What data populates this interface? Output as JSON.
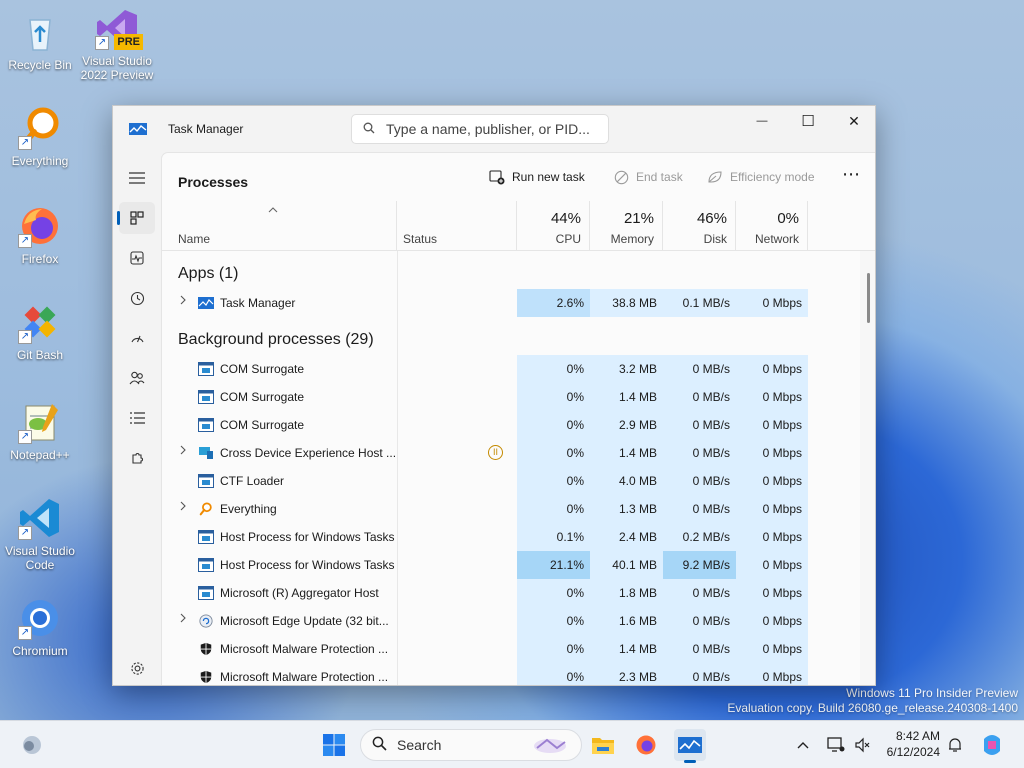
{
  "desktop": {
    "icons": [
      {
        "label": "Recycle Bin"
      },
      {
        "label": "Visual Studio 2022 Preview",
        "badge": "PRE"
      },
      {
        "label": "Everything"
      },
      {
        "label": "Firefox"
      },
      {
        "label": "Git Bash"
      },
      {
        "label": "Notepad++"
      },
      {
        "label": "Visual Studio Code"
      },
      {
        "label": "Chromium"
      }
    ],
    "watermark": {
      "line1": "Windows 11 Pro Insider Preview",
      "line2": "Evaluation copy. Build 26080.ge_release.240308-1400"
    }
  },
  "window": {
    "title": "Task Manager",
    "search_placeholder": "Type a name, publisher, or PID...",
    "controls": {
      "minimize": "—",
      "maximize": "☐",
      "close": "✕"
    }
  },
  "toolbar": {
    "page_title": "Processes",
    "run_new_task": "Run new task",
    "end_task": "End task",
    "efficiency_mode": "Efficiency mode",
    "more": "⋯"
  },
  "columns": {
    "name": "Name",
    "status": "Status",
    "cpu": {
      "pct": "44%",
      "label": "CPU"
    },
    "memory": {
      "pct": "21%",
      "label": "Memory"
    },
    "disk": {
      "pct": "46%",
      "label": "Disk"
    },
    "network": {
      "pct": "0%",
      "label": "Network"
    }
  },
  "groups": {
    "apps": "Apps (1)",
    "background": "Background processes (29)"
  },
  "apps": [
    {
      "name": "Task Manager",
      "cpu": "2.6%",
      "memory": "38.8 MB",
      "disk": "0.1 MB/s",
      "network": "0 Mbps",
      "expandable": true
    }
  ],
  "processes": [
    {
      "name": "COM Surrogate",
      "cpu": "0%",
      "memory": "3.2 MB",
      "disk": "0 MB/s",
      "network": "0 Mbps"
    },
    {
      "name": "COM Surrogate",
      "cpu": "0%",
      "memory": "1.4 MB",
      "disk": "0 MB/s",
      "network": "0 Mbps"
    },
    {
      "name": "COM Surrogate",
      "cpu": "0%",
      "memory": "2.9 MB",
      "disk": "0 MB/s",
      "network": "0 Mbps"
    },
    {
      "name": "Cross Device Experience Host ...",
      "cpu": "0%",
      "memory": "1.4 MB",
      "disk": "0 MB/s",
      "network": "0 Mbps",
      "expandable": true,
      "status_icon": "paused"
    },
    {
      "name": "CTF Loader",
      "cpu": "0%",
      "memory": "4.0 MB",
      "disk": "0 MB/s",
      "network": "0 Mbps"
    },
    {
      "name": "Everything",
      "cpu": "0%",
      "memory": "1.3 MB",
      "disk": "0 MB/s",
      "network": "0 Mbps",
      "expandable": true
    },
    {
      "name": "Host Process for Windows Tasks",
      "cpu": "0.1%",
      "memory": "2.4 MB",
      "disk": "0.2 MB/s",
      "network": "0 Mbps"
    },
    {
      "name": "Host Process for Windows Tasks",
      "cpu": "21.1%",
      "memory": "40.1 MB",
      "disk": "9.2 MB/s",
      "network": "0 Mbps"
    },
    {
      "name": "Microsoft (R) Aggregator Host",
      "cpu": "0%",
      "memory": "1.8 MB",
      "disk": "0 MB/s",
      "network": "0 Mbps"
    },
    {
      "name": "Microsoft Edge Update (32 bit...",
      "cpu": "0%",
      "memory": "1.6 MB",
      "disk": "0 MB/s",
      "network": "0 Mbps",
      "expandable": true
    },
    {
      "name": "Microsoft Malware Protection ...",
      "cpu": "0%",
      "memory": "1.4 MB",
      "disk": "0 MB/s",
      "network": "0 Mbps"
    },
    {
      "name": "Microsoft Malware Protection ...",
      "cpu": "0%",
      "memory": "2.3 MB",
      "disk": "0 MB/s",
      "network": "0 Mbps"
    }
  ],
  "taskbar": {
    "search_label": "Search",
    "time": "8:42 AM",
    "date": "6/12/2024"
  },
  "colors": {
    "accent": "#005fb8",
    "heat_low": "#dcefff",
    "heat_mid": "#bfe1fb",
    "heat_high": "#a6d6f7"
  }
}
